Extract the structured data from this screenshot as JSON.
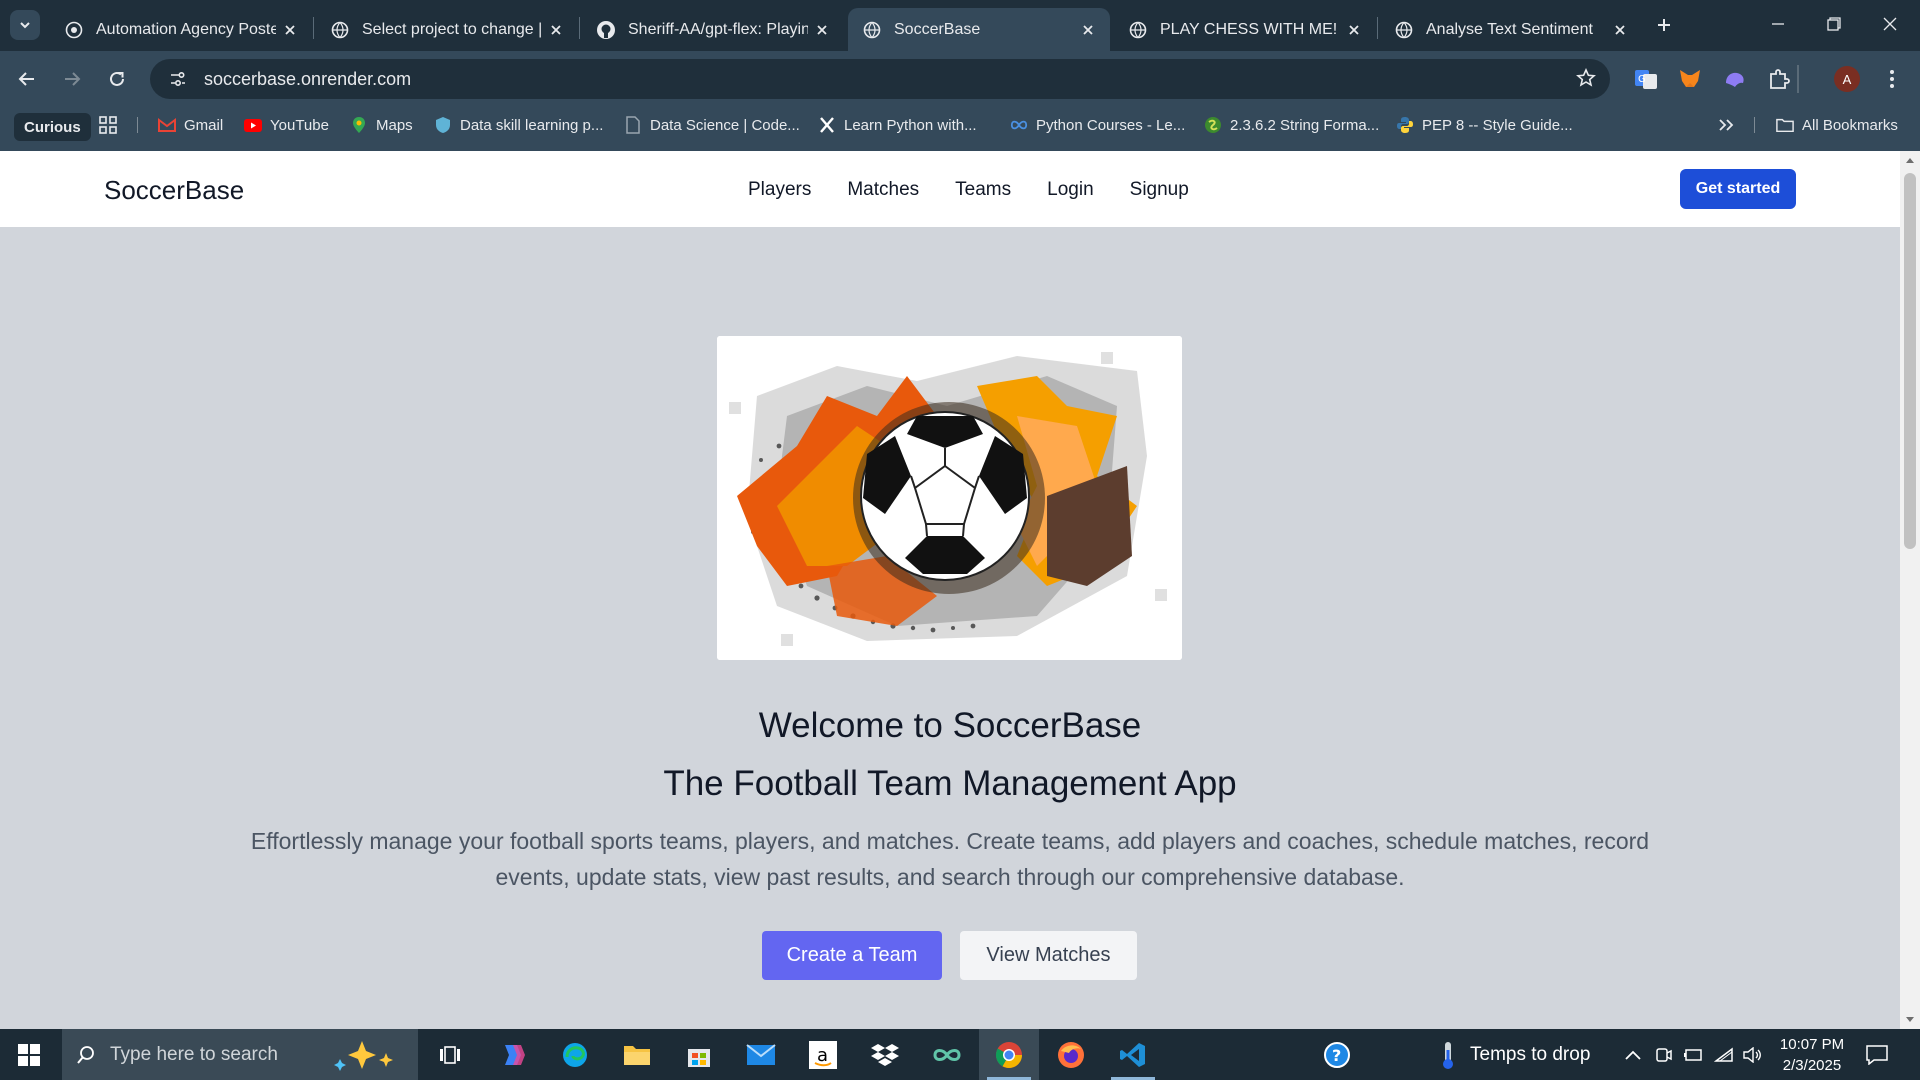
{
  "browser": {
    "tabs": [
      {
        "title": "Automation Agency Poster",
        "active": false
      },
      {
        "title": "Select project to change | D",
        "active": false
      },
      {
        "title": "Sheriff-AA/gpt-flex: Playing",
        "active": false
      },
      {
        "title": "SoccerBase",
        "active": true
      },
      {
        "title": "PLAY CHESS WITH ME!",
        "active": false
      },
      {
        "title": "Analyse Text Sentiment",
        "active": false
      }
    ],
    "url": "soccerbase.onrender.com",
    "profile_initial": "A",
    "bookmarks": [
      {
        "label": "Curious",
        "icon": "curious-badge"
      },
      {
        "label": "Gmail",
        "icon": "gmail-icon"
      },
      {
        "label": "YouTube",
        "icon": "youtube-icon"
      },
      {
        "label": "Maps",
        "icon": "maps-icon"
      },
      {
        "label": "Data skill learning p...",
        "icon": "shield-icon"
      },
      {
        "label": "Data Science | Code...",
        "icon": "page-icon"
      },
      {
        "label": "Learn Python with...",
        "icon": "x-icon"
      },
      {
        "label": "Python Courses - Le...",
        "icon": "infinity-icon"
      },
      {
        "label": "2.3.6.2 String Forma...",
        "icon": "snake-icon"
      },
      {
        "label": "PEP 8 -- Style Guide...",
        "icon": "python-icon"
      }
    ],
    "all_bookmarks": "All Bookmarks"
  },
  "site": {
    "brand": "SoccerBase",
    "nav": [
      "Players",
      "Matches",
      "Teams",
      "Login",
      "Signup"
    ],
    "cta": "Get started",
    "heading1": "Welcome to SoccerBase",
    "heading2": "The Football Team Management App",
    "description": "Effortlessly manage your football sports teams, players, and matches. Create teams, add players and coaches, schedule matches, record events, update stats, view past results, and search through our comprehensive database.",
    "primary_button": "Create a Team",
    "secondary_button": "View Matches",
    "colors": {
      "accent": "#1d4ed8",
      "primary_button": "#6366f1",
      "page_bg": "#d1d5db"
    }
  },
  "taskbar": {
    "search_placeholder": "Type here to search",
    "weather_text": "Temps to drop",
    "time": "10:07 PM",
    "date": "2/3/2025"
  }
}
